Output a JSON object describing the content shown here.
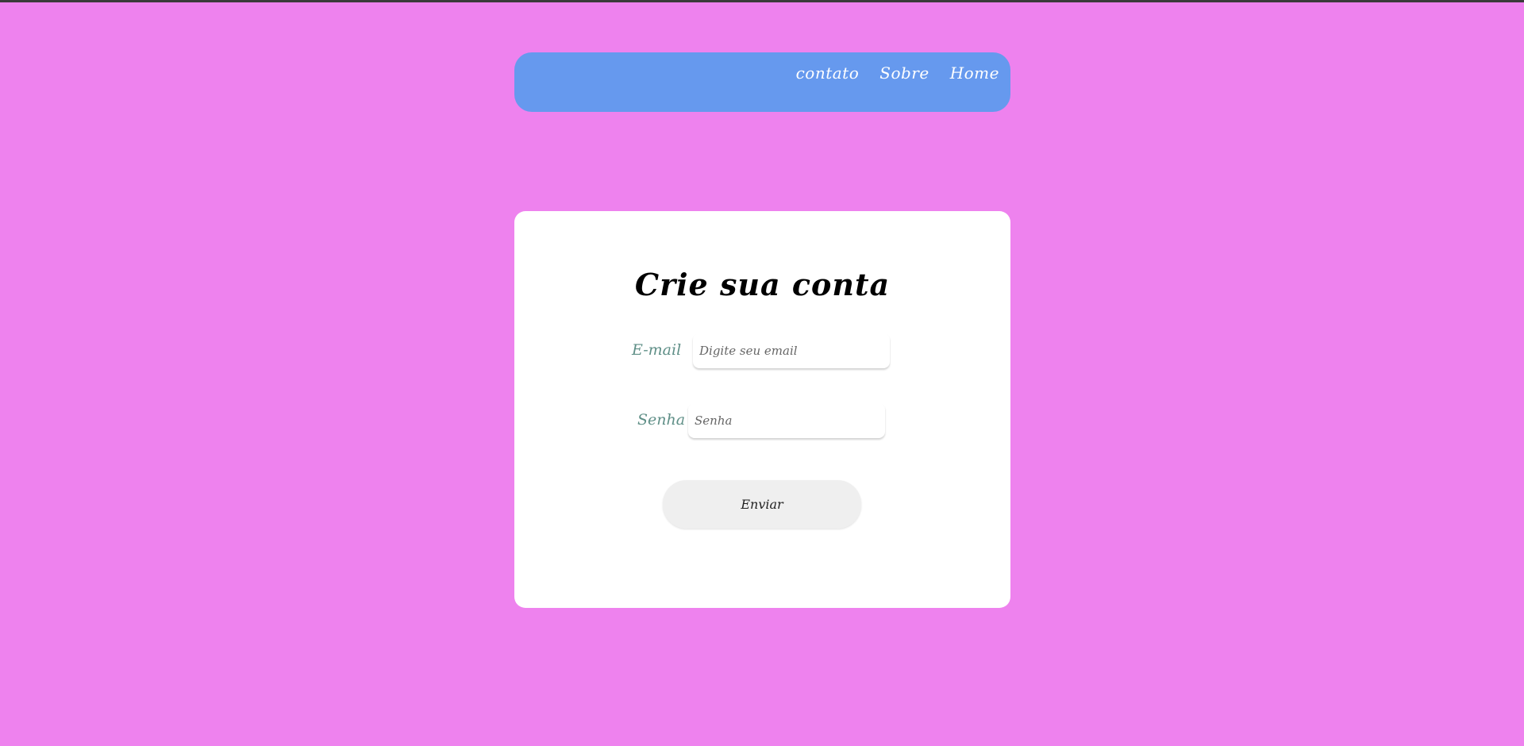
{
  "colors": {
    "background": "#ee82ee",
    "nav_background": "#6699ee",
    "card_background": "#ffffff",
    "label_color": "#5f8f87",
    "button_background": "#efefef"
  },
  "nav": {
    "links": [
      {
        "label": "contato"
      },
      {
        "label": "Sobre"
      },
      {
        "label": "Home"
      }
    ]
  },
  "form": {
    "title": "Crie sua conta",
    "email": {
      "label": "E-mail",
      "placeholder": "Digite seu email",
      "value": ""
    },
    "password": {
      "label": "Senha",
      "placeholder": "Senha",
      "value": ""
    },
    "submit_label": "Enviar"
  }
}
